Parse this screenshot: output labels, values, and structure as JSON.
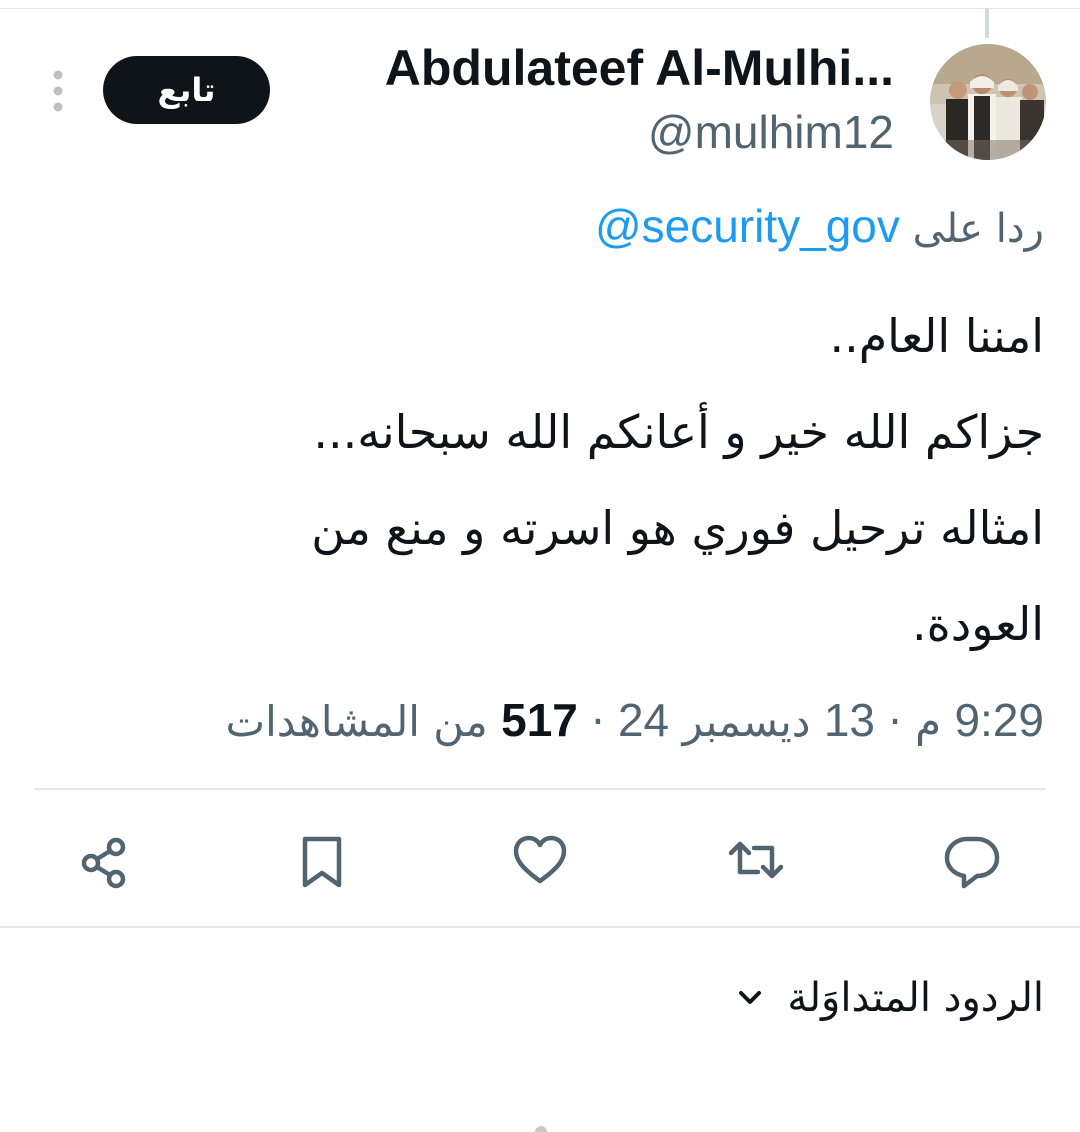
{
  "author": {
    "display_name": "Abdulateef Al-Mulhi...",
    "handle": "@mulhim12",
    "avatar_icon": "profile-photo"
  },
  "header": {
    "follow_label": "تابع",
    "more_icon": "more-vertical-icon"
  },
  "reply_context": {
    "prefix": "ردا على",
    "mention": "@security_gov"
  },
  "tweet": {
    "lines": [
      "امننا العام..",
      "جزاكم الله خير و أعانكم الله سبحانه...",
      "امثاله ترحيل فوري هو اسرته و منع من",
      "العودة."
    ]
  },
  "meta": {
    "time": "9:29",
    "ampm": "م",
    "separator": "·",
    "day": "13",
    "month": "ديسمبر",
    "year": "24",
    "views_count": "517",
    "views_label": "من المشاهدات"
  },
  "actions": {
    "reply_icon": "reply-icon",
    "retweet_icon": "retweet-icon",
    "like_icon": "heart-icon",
    "bookmark_icon": "bookmark-icon",
    "share_icon": "share-icon"
  },
  "replies_sort": {
    "label": "الردود المتداوَلة",
    "icon": "chevron-down-icon"
  },
  "colors": {
    "text_primary": "#0f1419",
    "text_secondary": "#536471",
    "link": "#1d9bf0",
    "follow_bg": "#0f1419",
    "divider": "#e5e8ea"
  }
}
